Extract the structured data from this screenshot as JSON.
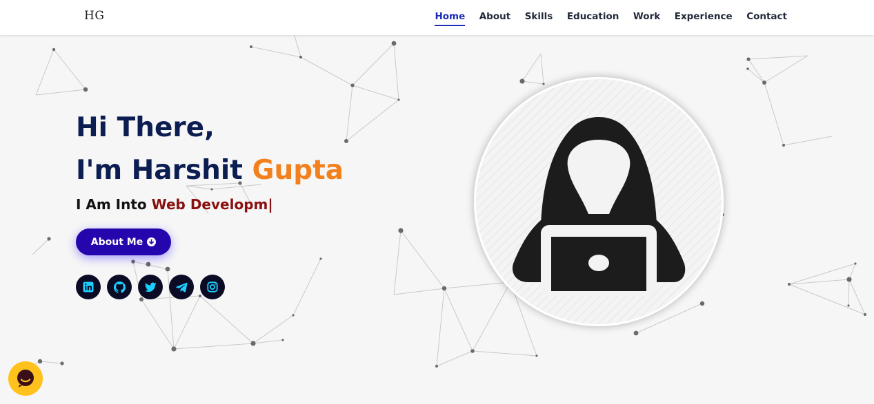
{
  "brand": {
    "logo_text": "HG"
  },
  "nav": {
    "items": [
      {
        "label": "Home",
        "active": true
      },
      {
        "label": "About"
      },
      {
        "label": "Skills"
      },
      {
        "label": "Education"
      },
      {
        "label": "Work"
      },
      {
        "label": "Experience"
      },
      {
        "label": "Contact"
      }
    ]
  },
  "hero": {
    "greeting": "Hi There,",
    "name_prefix": "I'm Harshit ",
    "name_accent": "Gupta",
    "into_prefix": "I Am Into ",
    "typed_text": "Web Developm",
    "cursor": "|",
    "about_button_label": "About Me",
    "about_button_icon": "arrow-circle-down-icon"
  },
  "socials": [
    {
      "name": "linkedin",
      "icon": "linkedin-icon"
    },
    {
      "name": "github",
      "icon": "github-icon"
    },
    {
      "name": "twitter",
      "icon": "twitter-icon"
    },
    {
      "name": "telegram",
      "icon": "telegram-icon"
    },
    {
      "name": "instagram",
      "icon": "instagram-icon"
    }
  ],
  "avatar": {
    "icon": "hacker-icon"
  },
  "chat_widget": {
    "icon": "chat-icon"
  },
  "colors": {
    "primary_dark": "#0b1d51",
    "accent_orange": "#f2811d",
    "typed_red": "#8a1010",
    "button_blue": "#2506ad",
    "social_icon": "#1bd0ff",
    "nav_active": "#1b2db8",
    "chat_yellow": "#ffc21c"
  }
}
